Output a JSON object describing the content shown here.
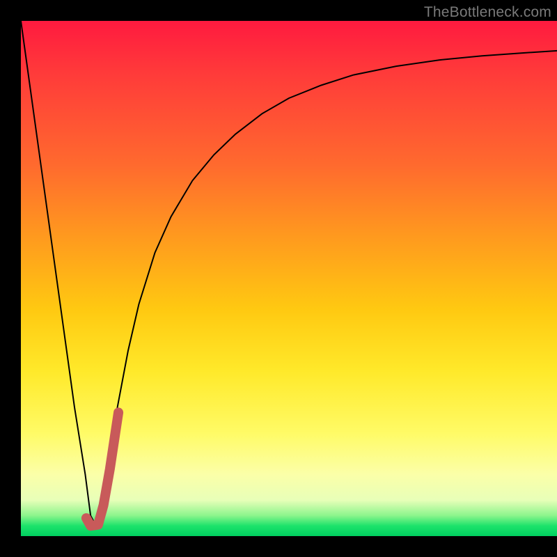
{
  "watermark": "TheBottleneck.com",
  "chart_data": {
    "type": "line",
    "title": "",
    "xlabel": "",
    "ylabel": "",
    "xlim": [
      0,
      100
    ],
    "ylim": [
      0,
      100
    ],
    "gradient_stops": [
      {
        "pos": 0,
        "color": "#ff1a3f"
      },
      {
        "pos": 10,
        "color": "#ff3a3a"
      },
      {
        "pos": 28,
        "color": "#ff6a2e"
      },
      {
        "pos": 42,
        "color": "#ff9a1e"
      },
      {
        "pos": 56,
        "color": "#ffc911"
      },
      {
        "pos": 68,
        "color": "#ffe92a"
      },
      {
        "pos": 80,
        "color": "#fffb66"
      },
      {
        "pos": 88,
        "color": "#fbffa8"
      },
      {
        "pos": 93,
        "color": "#e8ffb8"
      },
      {
        "pos": 96,
        "color": "#8cf58c"
      },
      {
        "pos": 98,
        "color": "#1de36b"
      },
      {
        "pos": 100,
        "color": "#00d060"
      }
    ],
    "series": [
      {
        "name": "main-curve",
        "stroke": "#000000",
        "stroke_width": 2,
        "x": [
          0,
          2,
          4,
          6,
          8,
          10,
          12,
          13,
          14,
          15,
          16,
          18,
          20,
          22,
          25,
          28,
          32,
          36,
          40,
          45,
          50,
          56,
          62,
          70,
          78,
          86,
          94,
          100
        ],
        "y": [
          100,
          85,
          70,
          55,
          40,
          25,
          12,
          4,
          2,
          4,
          12,
          25,
          36,
          45,
          55,
          62,
          69,
          74,
          78,
          82,
          85,
          87.5,
          89.5,
          91.2,
          92.4,
          93.2,
          93.8,
          94.2
        ]
      },
      {
        "name": "highlight-hook",
        "stroke": "#c85a5a",
        "stroke_width": 14,
        "linecap": "round",
        "x": [
          12.2,
          13.0,
          14.4,
          15.4,
          16.6,
          18.2
        ],
        "y": [
          3.5,
          2.0,
          2.2,
          6.0,
          13.0,
          24.0
        ]
      }
    ]
  }
}
